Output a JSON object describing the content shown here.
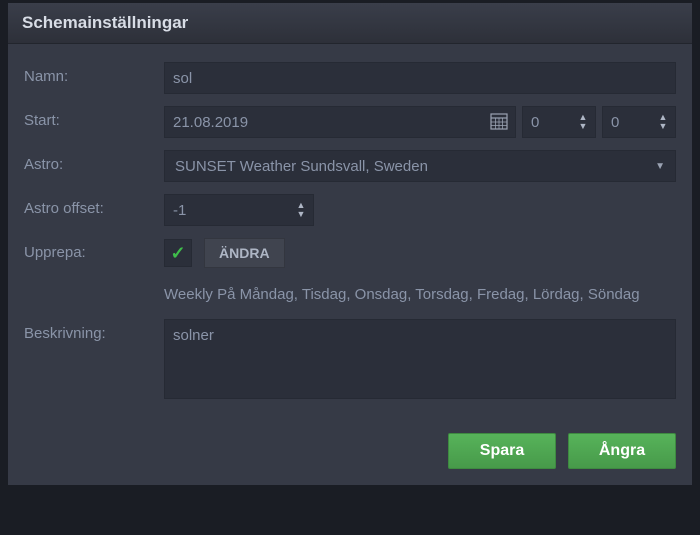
{
  "dialog": {
    "title": "Schemainställningar"
  },
  "labels": {
    "name": "Namn:",
    "start": "Start:",
    "astro": "Astro:",
    "astroOffset": "Astro offset:",
    "repeat": "Upprepa:",
    "description": "Beskrivning:"
  },
  "fields": {
    "name": "sol",
    "date": "21.08.2019",
    "hour": "0",
    "minute": "0",
    "astro": "SUNSET Weather Sundsvall, Sweden",
    "astroOffset": "-1",
    "repeatChecked": true,
    "changeButton": "ÄNDRA",
    "repeatSummary": "Weekly På Måndag, Tisdag, Onsdag, Torsdag, Fredag, Lördag, Söndag",
    "description": "solner"
  },
  "actions": {
    "save": "Spara",
    "undo": "Ångra"
  }
}
